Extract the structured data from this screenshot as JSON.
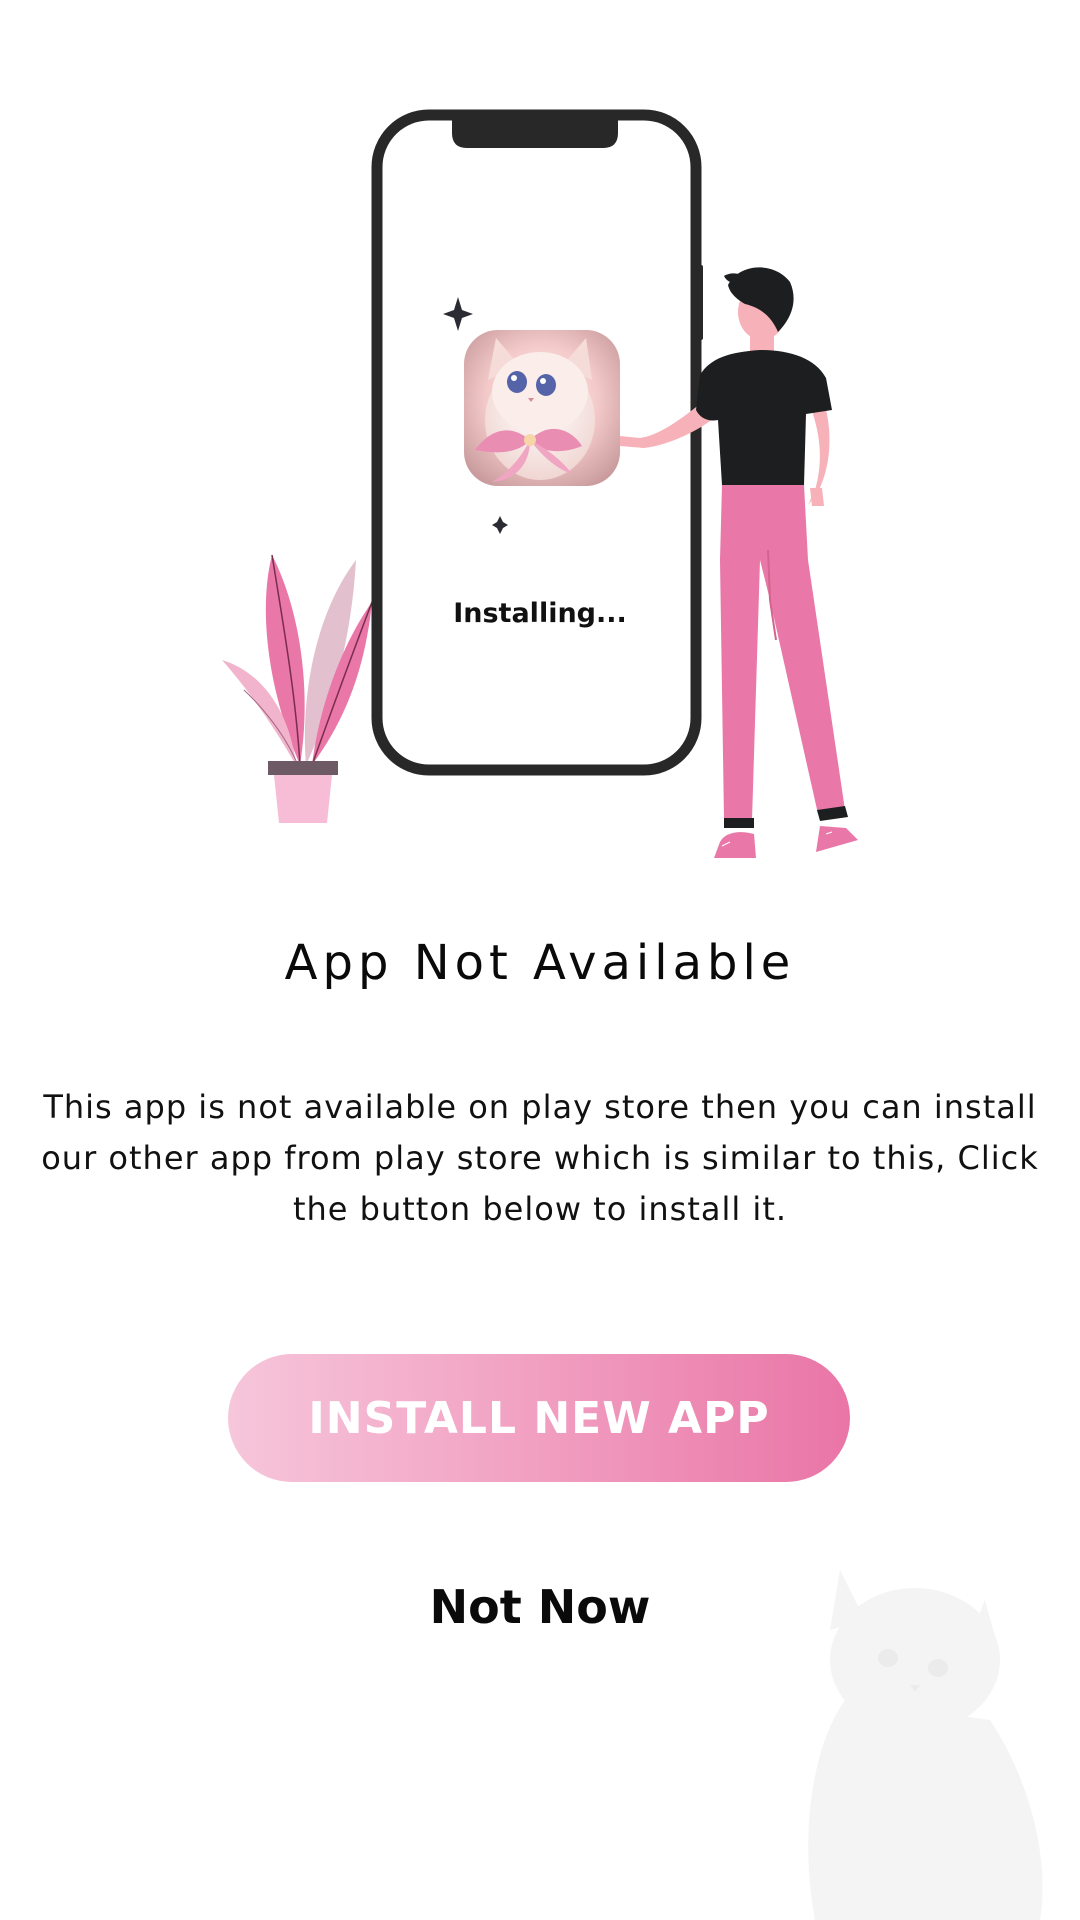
{
  "illustration": {
    "status_text": "Installing..."
  },
  "dialog": {
    "title": "App Not Available",
    "description": "This app is not available on play store then you can install our other app from play store which is similar to this, Click the button below to install it.",
    "install_button_label": "INSTALL NEW APP",
    "dismiss_label": "Not Now"
  },
  "icons": {
    "app_icon": "kitten-app-icon",
    "watermark": "kitten-watermark",
    "sparkles": "sparkle-icon"
  },
  "colors": {
    "accent_pink": "#e975a6",
    "light_pink": "#f6c6db",
    "phone_frame": "#282828",
    "shirt": "#1c1e1f"
  }
}
